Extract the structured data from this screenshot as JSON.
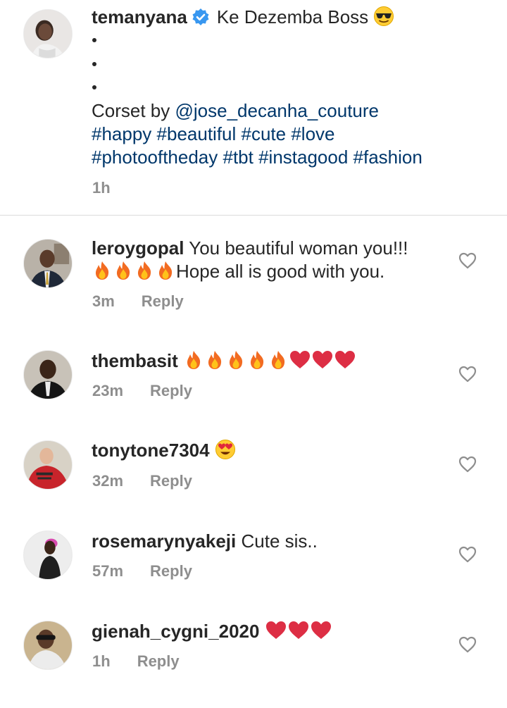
{
  "caption": {
    "username": "temanyana",
    "title": "Ke Dezemba Boss",
    "title_emoji": "sunglasses-face-emoji",
    "bullets": [
      "•",
      "•",
      "•"
    ],
    "line1_prefix": "Corset by",
    "mention": "@jose_decanha_couture",
    "hashtags_line1": "#happy #beautiful #cute #love",
    "hashtags_line2": "#photooftheday #tbt #instagood #fashion",
    "time": "1h"
  },
  "comments": [
    {
      "username": "leroygopal",
      "text": "You beautiful woman you!!!",
      "text2": "Hope all is good with you.",
      "emojis": [
        "fire",
        "fire",
        "fire",
        "fire"
      ],
      "time": "3m",
      "reply_label": "Reply"
    },
    {
      "username": "thembasit",
      "text": "",
      "emojis": [
        "fire",
        "fire",
        "fire",
        "fire",
        "fire",
        "red-heart",
        "red-heart",
        "red-heart"
      ],
      "time": "23m",
      "reply_label": "Reply"
    },
    {
      "username": "tonytone7304",
      "text": "",
      "emojis": [
        "heart-eyes"
      ],
      "time": "32m",
      "reply_label": "Reply"
    },
    {
      "username": "rosemarynyakeji",
      "text": "Cute sis..",
      "emojis": [],
      "time": "57m",
      "reply_label": "Reply"
    },
    {
      "username": "gienah_cygni_2020",
      "text": "",
      "emojis": [
        "red-heart",
        "red-heart",
        "red-heart"
      ],
      "time": "1h",
      "reply_label": "Reply"
    }
  ],
  "colors": {
    "text": "#262626",
    "hashtag": "#00376b",
    "meta": "#8e8e8e",
    "verified": "#3897f0",
    "divider": "#dbdbdb"
  }
}
